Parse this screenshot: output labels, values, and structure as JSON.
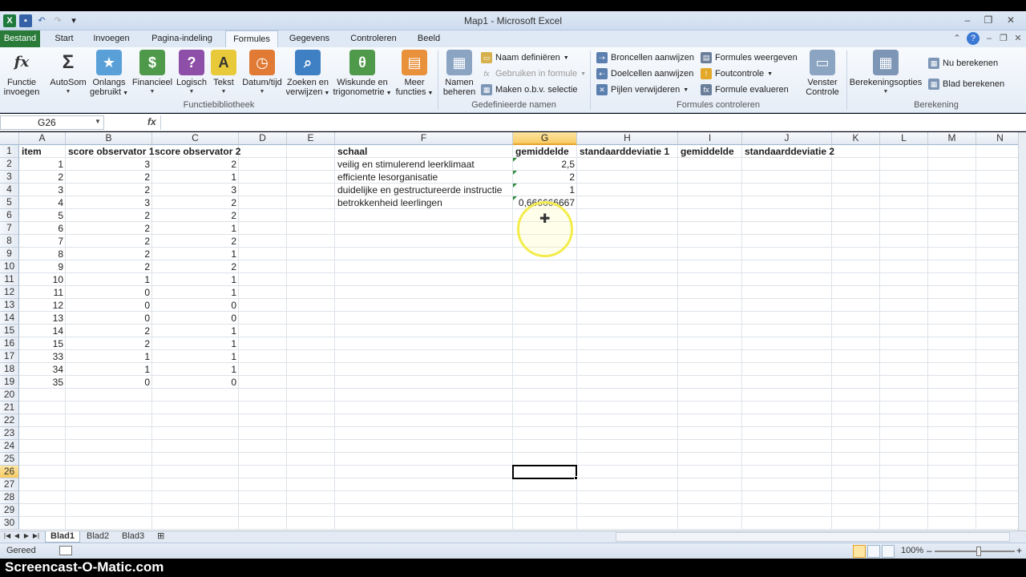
{
  "window": {
    "title": "Map1 - Microsoft Excel"
  },
  "tabs": [
    {
      "label": "Bestand"
    },
    {
      "label": "Start"
    },
    {
      "label": "Invoegen"
    },
    {
      "label": "Pagina-indeling"
    },
    {
      "label": "Formules"
    },
    {
      "label": "Gegevens"
    },
    {
      "label": "Controleren"
    },
    {
      "label": "Beeld"
    }
  ],
  "active_tab": "Formules",
  "ribbon": {
    "functiebibliotheek": {
      "label": "Functiebibliotheek",
      "buttons": [
        {
          "l1": "Functie",
          "l2": "invoegen"
        },
        {
          "l1": "AutoSom",
          "l2": ""
        },
        {
          "l1": "Onlangs",
          "l2": "gebruikt"
        },
        {
          "l1": "Financieel",
          "l2": ""
        },
        {
          "l1": "Logisch",
          "l2": ""
        },
        {
          "l1": "Tekst",
          "l2": ""
        },
        {
          "l1": "Datum/tijd",
          "l2": ""
        },
        {
          "l1": "Zoeken en",
          "l2": "verwijzen"
        },
        {
          "l1": "Wiskunde en",
          "l2": "trigonometrie"
        },
        {
          "l1": "Meer",
          "l2": "functies"
        }
      ]
    },
    "gedefinieerde_namen": {
      "label": "Gedefinieerde namen",
      "namen_beheren": {
        "l1": "Namen",
        "l2": "beheren"
      },
      "naam_definieren": "Naam definiëren",
      "gebruiken_in_formule": "Gebruiken in formule",
      "maken_obv_selectie": "Maken o.b.v. selectie"
    },
    "formules_controleren": {
      "label": "Formules controleren",
      "broncellen": "Broncellen aanwijzen",
      "doelcellen": "Doelcellen aanwijzen",
      "pijlen": "Pijlen verwijderen",
      "formules_weergeven": "Formules weergeven",
      "foutcontrole": "Foutcontrole",
      "formule_evalueren": "Formule evalueren",
      "venster": {
        "l1": "Venster",
        "l2": "Controle"
      }
    },
    "berekening": {
      "label": "Berekening",
      "opties": "Berekeningsopties",
      "nu": "Nu berekenen",
      "blad": "Blad berekenen"
    }
  },
  "formula_bar": {
    "name_box": "G26",
    "fx": "fx",
    "content": ""
  },
  "grid": {
    "columns": [
      "A",
      "B",
      "C",
      "D",
      "E",
      "F",
      "G",
      "H",
      "I",
      "J",
      "K",
      "L",
      "M",
      "N"
    ],
    "rows": [
      "1",
      "2",
      "3",
      "4",
      "5",
      "6",
      "7",
      "8",
      "9",
      "10",
      "11",
      "12",
      "13",
      "14",
      "15",
      "16",
      "17",
      "18",
      "19",
      "20",
      "21",
      "22",
      "23",
      "24",
      "25",
      "26",
      "27",
      "28",
      "29",
      "30"
    ],
    "selected_column": "G",
    "selected_row": "26",
    "headers": {
      "A1": "item",
      "B1": "score observator 1",
      "C1": "score observator 2",
      "F1": "schaal",
      "G1": "gemiddelde",
      "H1": "standaarddeviatie 1",
      "I1": "gemiddelde",
      "J1": "standaarddeviatie 2"
    },
    "data_rows": [
      {
        "item": "1",
        "obs1": "3",
        "obs2": "2"
      },
      {
        "item": "2",
        "obs1": "2",
        "obs2": "1"
      },
      {
        "item": "3",
        "obs1": "2",
        "obs2": "3"
      },
      {
        "item": "4",
        "obs1": "3",
        "obs2": "2"
      },
      {
        "item": "5",
        "obs1": "2",
        "obs2": "2"
      },
      {
        "item": "6",
        "obs1": "2",
        "obs2": "1"
      },
      {
        "item": "7",
        "obs1": "2",
        "obs2": "2"
      },
      {
        "item": "8",
        "obs1": "2",
        "obs2": "1"
      },
      {
        "item": "9",
        "obs1": "2",
        "obs2": "2"
      },
      {
        "item": "10",
        "obs1": "1",
        "obs2": "1"
      },
      {
        "item": "11",
        "obs1": "0",
        "obs2": "1"
      },
      {
        "item": "12",
        "obs1": "0",
        "obs2": "0"
      },
      {
        "item": "13",
        "obs1": "0",
        "obs2": "0"
      },
      {
        "item": "14",
        "obs1": "2",
        "obs2": "1"
      },
      {
        "item": "15",
        "obs1": "2",
        "obs2": "1"
      },
      {
        "item": "33",
        "obs1": "1",
        "obs2": "1"
      },
      {
        "item": "34",
        "obs1": "1",
        "obs2": "1"
      },
      {
        "item": "35",
        "obs1": "0",
        "obs2": "0"
      }
    ],
    "scales": [
      {
        "name": "veilig en stimulerend leerklimaat",
        "mean": "2,5"
      },
      {
        "name": "efficiente lesorganisatie",
        "mean": "2"
      },
      {
        "name": "duidelijke en gestructureerde instructie",
        "mean": "1"
      },
      {
        "name": "betrokkenheid leerlingen",
        "mean": "0,666666667"
      }
    ]
  },
  "sheets": [
    {
      "name": "Blad1"
    },
    {
      "name": "Blad2"
    },
    {
      "name": "Blad3"
    }
  ],
  "active_sheet": "Blad1",
  "status": {
    "text": "Gereed",
    "zoom": "100%"
  },
  "watermark": "Screencast-O-Matic.com",
  "colors": {
    "file_tab": "#2a7a3a",
    "selection_header": "#f8cb63",
    "cursor_ring": "#f3ec4b"
  }
}
